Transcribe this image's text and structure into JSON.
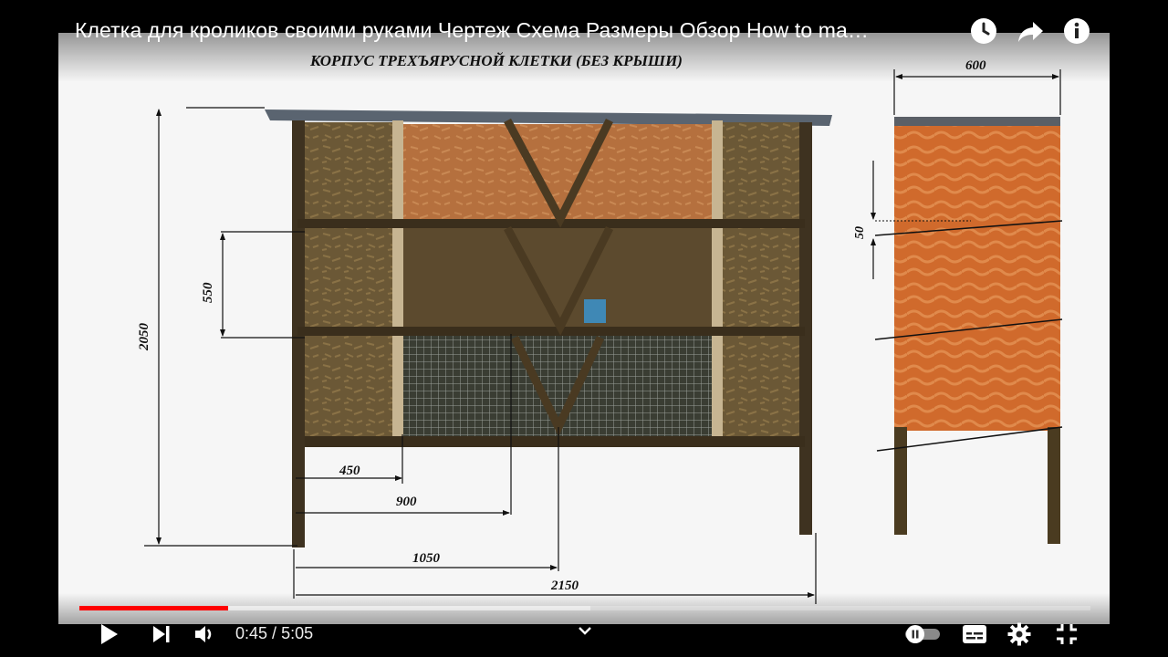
{
  "video": {
    "title": "Клетка для кроликов своими руками Чертеж Схема Размеры Обзор How to ma…"
  },
  "top_controls": {
    "watch_later_icon": "clock-icon",
    "share_icon": "share-arrow-icon",
    "info_icon": "info-icon"
  },
  "drawing": {
    "heading": "КОРПУС ТРЕХЪЯРУСНОЙ КЛЕТКИ (БЕЗ КРЫШИ)",
    "dims": {
      "height_total": "2050",
      "tier_height": "550",
      "w450": "450",
      "w900": "900",
      "w1050": "1050",
      "w2150": "2150",
      "depth": "600",
      "gap": "50"
    }
  },
  "player": {
    "progress_played": 0.147,
    "progress_loaded": 0.505,
    "current_time": "0:45",
    "separator": " / ",
    "duration": "5:05",
    "accent": "#ff0000",
    "icons": {
      "play": "play-icon",
      "next": "next-icon",
      "volume": "volume-icon",
      "chevron": "chevron-down-icon",
      "autoplay": "autoplay-toggle-icon",
      "subtitles": "subtitles-icon",
      "settings": "gear-icon",
      "exit_fullscreen": "exit-fullscreen-icon"
    }
  }
}
